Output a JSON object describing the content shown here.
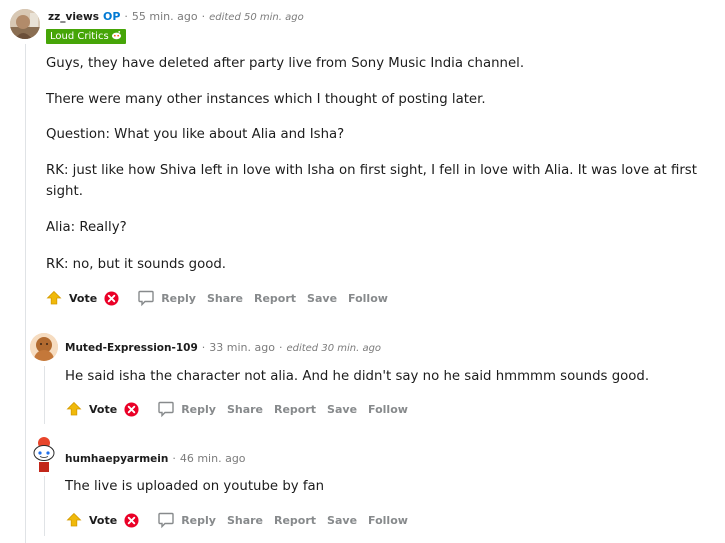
{
  "comments": [
    {
      "username": "zz_views",
      "op_badge": "OP",
      "time": "55 min. ago",
      "edited": "edited 50 min. ago",
      "flair": "Loud Critics",
      "paragraphs": [
        "Guys, they have deleted after party live from Sony Music India channel.",
        "There were many other instances which I thought of posting later.",
        "Question: What you like about Alia and Isha?",
        "RK: just like how Shiva left in love with Isha on first sight, I fell in love with Alia. It was love at first",
        "sight.",
        "Alia: Really?",
        "RK: no, but it sounds good."
      ]
    },
    {
      "username": "Muted-Expression-109",
      "time": "33 min. ago",
      "edited": "edited 30 min. ago",
      "paragraphs": [
        "He said isha the character not alia. And he didn't say no he said hmmmm sounds good."
      ]
    },
    {
      "username": "humhaepyarmein",
      "time": "46 min. ago",
      "paragraphs": [
        "The live is uploaded on youtube by fan"
      ]
    }
  ],
  "actions": {
    "vote": "Vote",
    "reply": "Reply",
    "share": "Share",
    "report": "Report",
    "save": "Save",
    "follow": "Follow"
  },
  "colors": {
    "flair_bg": "#46a508",
    "op_blue": "#0079d3",
    "downvote_red": "#ea0027",
    "upvote_yellow": "#f0b90a",
    "muted_text": "#7c7c7c"
  },
  "icons": [
    "upvote-icon",
    "downvote-icon",
    "reply-bubble-icon",
    "snoo-flair-icon"
  ]
}
